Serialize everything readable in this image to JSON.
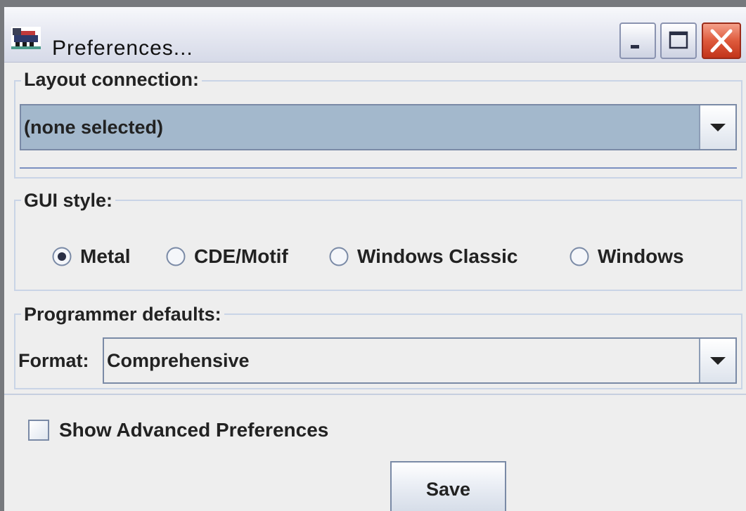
{
  "window": {
    "title": "Preferences...",
    "app_icon": "locomotive-icon",
    "controls": {
      "minimize_icon": "minimize-icon",
      "maximize_icon": "maximize-icon",
      "close_icon": "close-icon"
    }
  },
  "layout_connection": {
    "legend": "Layout connection:",
    "selected_value": "(none selected)",
    "dropdown_icon": "chevron-down-icon"
  },
  "gui_style": {
    "legend": "GUI style:",
    "options": [
      {
        "label": "Metal",
        "selected": true
      },
      {
        "label": "CDE/Motif",
        "selected": false
      },
      {
        "label": "Windows Classic",
        "selected": false
      },
      {
        "label": "Windows",
        "selected": false
      }
    ]
  },
  "programmer_defaults": {
    "legend": "Programmer defaults:",
    "format_label": "Format:",
    "format_value": "Comprehensive",
    "dropdown_icon": "chevron-down-icon"
  },
  "advanced": {
    "label": "Show Advanced Preferences",
    "checked": false
  },
  "actions": {
    "save_label": "Save"
  },
  "colors": {
    "background": "#eeeeee",
    "selected_combo": "#a3b8cc",
    "group_border": "#c9d4e6",
    "close_button": "#de5a3c"
  }
}
